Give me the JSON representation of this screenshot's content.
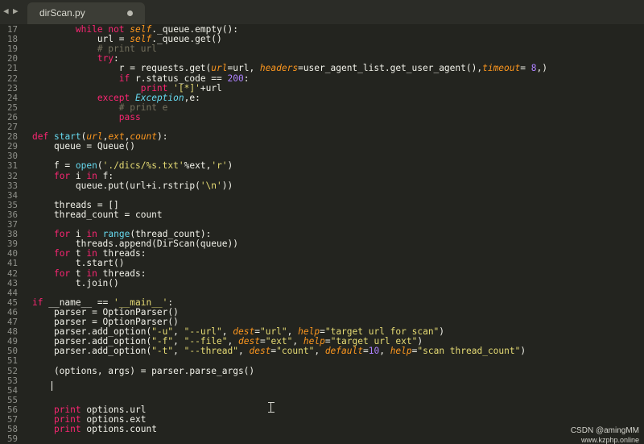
{
  "tabbar": {
    "nav_left": "◀",
    "nav_right": "▶",
    "tab": {
      "title": "dirScan.py"
    }
  },
  "editor": {
    "lines": [
      {
        "number": "17",
        "code": "        while not self._queue.empty():"
      },
      {
        "number": "18",
        "code": "            url = self._queue.get()"
      },
      {
        "number": "19",
        "code": "            # print url"
      },
      {
        "number": "20",
        "code": "            try:"
      },
      {
        "number": "21",
        "code": "                r = requests.get(url=url, headers=user_agent_list.get_user_agent(),timeout= 8,)"
      },
      {
        "number": "22",
        "code": "                if r.status_code == 200:"
      },
      {
        "number": "23",
        "code": "                    print '[*]'+url"
      },
      {
        "number": "24",
        "code": "            except Exception,e:"
      },
      {
        "number": "25",
        "code": "                # print e"
      },
      {
        "number": "26",
        "code": "                pass"
      },
      {
        "number": "27",
        "code": ""
      },
      {
        "number": "28",
        "code": "def start(url,ext,count):"
      },
      {
        "number": "29",
        "code": "    queue = Queue()"
      },
      {
        "number": "30",
        "code": ""
      },
      {
        "number": "31",
        "code": "    f = open('./dics/%s.txt'%ext,'r')"
      },
      {
        "number": "32",
        "code": "    for i in f:"
      },
      {
        "number": "33",
        "code": "        queue.put(url+i.rstrip('\\n'))"
      },
      {
        "number": "34",
        "code": ""
      },
      {
        "number": "35",
        "code": "    threads = []"
      },
      {
        "number": "36",
        "code": "    thread_count = count"
      },
      {
        "number": "37",
        "code": ""
      },
      {
        "number": "38",
        "code": "    for i in range(thread_count):"
      },
      {
        "number": "39",
        "code": "        threads.append(DirScan(queue))"
      },
      {
        "number": "40",
        "code": "    for t in threads:"
      },
      {
        "number": "41",
        "code": "        t.start()"
      },
      {
        "number": "42",
        "code": "    for t in threads:"
      },
      {
        "number": "43",
        "code": "        t.join()"
      },
      {
        "number": "44",
        "code": ""
      },
      {
        "number": "45",
        "code": "if __name__ == '__main__':"
      },
      {
        "number": "46",
        "code": "    parser = OptionParser()"
      },
      {
        "number": "47",
        "code": "    parser = OptionParser()"
      },
      {
        "number": "48",
        "code": "    parser.add_option(\"-u\", \"--url\", dest=\"url\", help=\"target url for scan\")"
      },
      {
        "number": "49",
        "code": "    parser.add_option(\"-f\", \"--file\", dest=\"ext\", help=\"target url ext\")"
      },
      {
        "number": "50",
        "code": "    parser.add_option(\"-t\", \"--thread\", dest=\"count\", default=10, help=\"scan thread_count\")"
      },
      {
        "number": "51",
        "code": ""
      },
      {
        "number": "52",
        "code": "    (options, args) = parser.parse_args()"
      },
      {
        "number": "53",
        "code": ""
      },
      {
        "number": "54",
        "code": ""
      },
      {
        "number": "55",
        "code": ""
      },
      {
        "number": "56",
        "code": "    print options.url"
      },
      {
        "number": "57",
        "code": "    print options.ext"
      },
      {
        "number": "58",
        "code": "    print options.count"
      },
      {
        "number": "59",
        "code": ""
      }
    ]
  },
  "watermark": {
    "line1": "CSDN @amingMM",
    "line2": "www.kzphp.online"
  },
  "colors": {
    "background": "#23241f",
    "keyword": "#f92672",
    "builtin": "#66d9ef",
    "string": "#e6db74",
    "number": "#ae81ff",
    "comment": "#75715e",
    "parameter": "#fd971f"
  }
}
